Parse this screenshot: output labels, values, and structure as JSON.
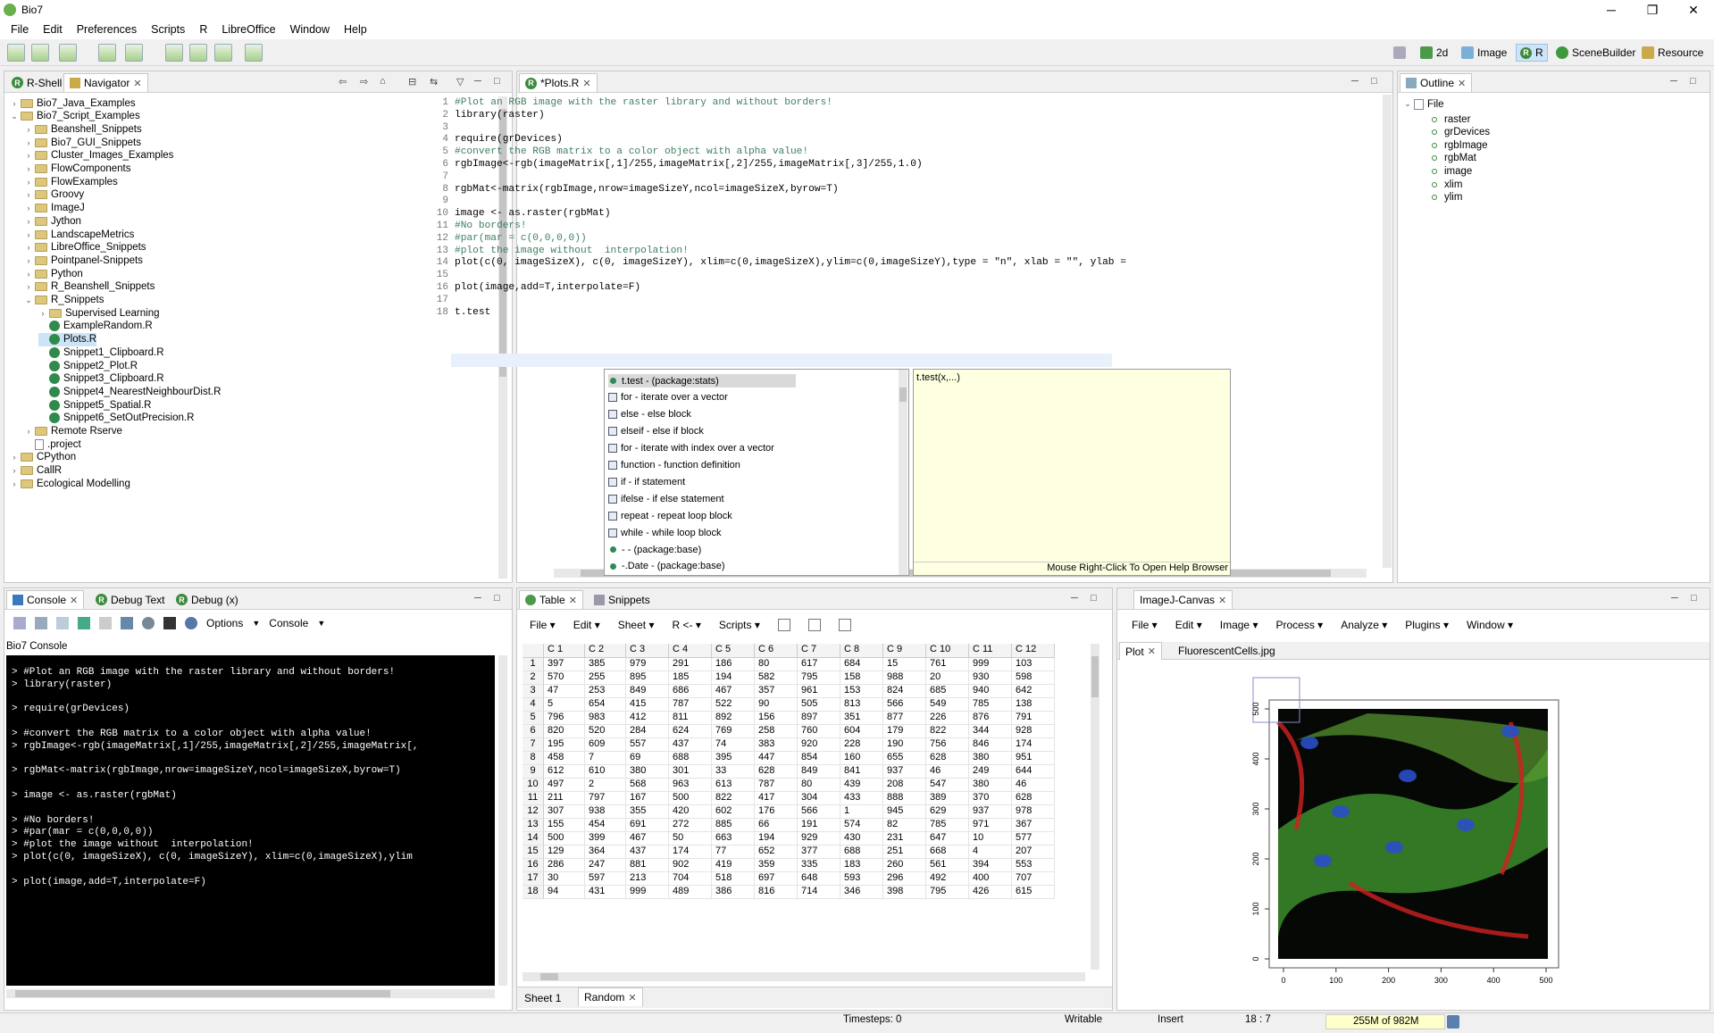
{
  "app": {
    "title": "Bio7"
  },
  "menu": [
    "File",
    "Edit",
    "Preferences",
    "Scripts",
    "R",
    "LibreOffice",
    "Window",
    "Help"
  ],
  "perspectives": [
    "2d",
    "Image",
    "R",
    "SceneBuilder",
    "Resource"
  ],
  "left_panel": {
    "tabs": [
      "R-Shell",
      "Navigator"
    ],
    "tree": [
      {
        "label": "Bio7_Java_Examples",
        "level": 0,
        "type": "folder",
        "arrow": "›"
      },
      {
        "label": "Bio7_Script_Examples",
        "level": 0,
        "type": "folder",
        "arrow": "⌄"
      },
      {
        "label": "Beanshell_Snippets",
        "level": 1,
        "type": "folder",
        "arrow": "›"
      },
      {
        "label": "Bio7_GUI_Snippets",
        "level": 1,
        "type": "folder",
        "arrow": "›"
      },
      {
        "label": "Cluster_Images_Examples",
        "level": 1,
        "type": "folder",
        "arrow": "›"
      },
      {
        "label": "FlowComponents",
        "level": 1,
        "type": "folder",
        "arrow": "›"
      },
      {
        "label": "FlowExamples",
        "level": 1,
        "type": "folder",
        "arrow": "›"
      },
      {
        "label": "Groovy",
        "level": 1,
        "type": "folder",
        "arrow": "›"
      },
      {
        "label": "ImageJ",
        "level": 1,
        "type": "folder",
        "arrow": "›"
      },
      {
        "label": "Jython",
        "level": 1,
        "type": "folder",
        "arrow": "›"
      },
      {
        "label": "LandscapeMetrics",
        "level": 1,
        "type": "folder",
        "arrow": "›"
      },
      {
        "label": "LibreOffice_Snippets",
        "level": 1,
        "type": "folder",
        "arrow": "›"
      },
      {
        "label": "Pointpanel-Snippets",
        "level": 1,
        "type": "folder",
        "arrow": "›"
      },
      {
        "label": "Python",
        "level": 1,
        "type": "folder",
        "arrow": "›"
      },
      {
        "label": "R_Beanshell_Snippets",
        "level": 1,
        "type": "folder",
        "arrow": "›"
      },
      {
        "label": "R_Snippets",
        "level": 1,
        "type": "folder",
        "arrow": "⌄"
      },
      {
        "label": "Supervised Learning",
        "level": 2,
        "type": "folder",
        "arrow": "›"
      },
      {
        "label": "ExampleRandom.R",
        "level": 2,
        "type": "file",
        "arrow": ""
      },
      {
        "label": "Plots.R",
        "level": 2,
        "type": "file",
        "arrow": "",
        "selected": true
      },
      {
        "label": "Snippet1_Clipboard.R",
        "level": 2,
        "type": "file",
        "arrow": ""
      },
      {
        "label": "Snippet2_Plot.R",
        "level": 2,
        "type": "file",
        "arrow": ""
      },
      {
        "label": "Snippet3_Clipboard.R",
        "level": 2,
        "type": "file",
        "arrow": ""
      },
      {
        "label": "Snippet4_NearestNeighbourDist.R",
        "level": 2,
        "type": "file",
        "arrow": ""
      },
      {
        "label": "Snippet5_Spatial.R",
        "level": 2,
        "type": "file",
        "arrow": ""
      },
      {
        "label": "Snippet6_SetOutPrecision.R",
        "level": 2,
        "type": "file",
        "arrow": ""
      },
      {
        "label": "Remote Rserve",
        "level": 1,
        "type": "folder",
        "arrow": "›"
      },
      {
        "label": ".project",
        "level": 1,
        "type": "doc",
        "arrow": ""
      },
      {
        "label": "CPython",
        "level": 0,
        "type": "folder",
        "arrow": "›"
      },
      {
        "label": "CallR",
        "level": 0,
        "type": "folder",
        "arrow": "›"
      },
      {
        "label": "Ecological Modelling",
        "level": 0,
        "type": "folder",
        "arrow": "›"
      }
    ]
  },
  "editor": {
    "tab": "*Plots.R",
    "lines": [
      {
        "n": "1",
        "text": "#Plot an RGB image with the raster library and without borders!",
        "comment": true
      },
      {
        "n": "2",
        "text": "library(raster)",
        "comment": false
      },
      {
        "n": "3",
        "text": "",
        "comment": false
      },
      {
        "n": "4",
        "text": "require(grDevices)",
        "comment": false
      },
      {
        "n": "5",
        "text": "#convert the RGB matrix to a color object with alpha value!",
        "comment": true
      },
      {
        "n": "6",
        "text": "rgbImage<-rgb(imageMatrix[,1]/255,imageMatrix[,2]/255,imageMatrix[,3]/255,1.0)",
        "comment": false
      },
      {
        "n": "7",
        "text": "",
        "comment": false
      },
      {
        "n": "8",
        "text": "rgbMat<-matrix(rgbImage,nrow=imageSizeY,ncol=imageSizeX,byrow=T)",
        "comment": false
      },
      {
        "n": "9",
        "text": "",
        "comment": false
      },
      {
        "n": "10",
        "text": "image <- as.raster(rgbMat)",
        "comment": false
      },
      {
        "n": "11",
        "text": "#No borders!",
        "comment": true
      },
      {
        "n": "12",
        "text": "#par(mar = c(0,0,0,0))",
        "comment": true
      },
      {
        "n": "13",
        "text": "#plot the image without  interpolation!",
        "comment": true
      },
      {
        "n": "14",
        "text": "plot(c(0, imageSizeX), c(0, imageSizeY), xlim=c(0,imageSizeX),ylim=c(0,imageSizeY),type = \"n\", xlab = \"\", ylab =",
        "comment": false
      },
      {
        "n": "15",
        "text": "",
        "comment": false
      },
      {
        "n": "16",
        "text": "plot(image,add=T,interpolate=F)",
        "comment": false
      },
      {
        "n": "17",
        "text": "",
        "comment": false
      },
      {
        "n": "18",
        "text": "t.test",
        "comment": false
      }
    ],
    "autocomplete": {
      "items": [
        {
          "label": "t.test - (package:stats)",
          "kind": "dot"
        },
        {
          "label": "for - iterate over a vector",
          "kind": "tpl"
        },
        {
          "label": "else - else block",
          "kind": "tpl"
        },
        {
          "label": "elseif - else if block",
          "kind": "tpl"
        },
        {
          "label": "for - iterate with index over a vector",
          "kind": "tpl"
        },
        {
          "label": "function - function definition",
          "kind": "tpl"
        },
        {
          "label": "if - if statement",
          "kind": "tpl"
        },
        {
          "label": "ifelse - if else statement",
          "kind": "tpl"
        },
        {
          "label": "repeat - repeat loop block",
          "kind": "tpl"
        },
        {
          "label": "while - while loop block",
          "kind": "tpl"
        },
        {
          "label": "- - (package:base)",
          "kind": "dot"
        },
        {
          "label": "-.Date - (package:base)",
          "kind": "dot"
        }
      ],
      "help_signature": "t.test(x,...)",
      "help_footer": "Mouse Right-Click To Open Help Browser"
    }
  },
  "outline": {
    "tab": "Outline",
    "root": "File",
    "items": [
      "raster",
      "grDevices",
      "rgbImage",
      "rgbMat",
      "image",
      "xlim",
      "ylim"
    ]
  },
  "console": {
    "tabs": [
      "Console",
      "Debug Text",
      "Debug (x)"
    ],
    "toolbar": {
      "options": "Options",
      "console": "Console"
    },
    "title": "Bio7 Console",
    "lines": [
      "> #Plot an RGB image with the raster library and without borders!",
      "> library(raster)",
      "",
      "> require(grDevices)",
      "",
      "> #convert the RGB matrix to a color object with alpha value!",
      "> rgbImage<-rgb(imageMatrix[,1]/255,imageMatrix[,2]/255,imageMatrix[,",
      "",
      "> rgbMat<-matrix(rgbImage,nrow=imageSizeY,ncol=imageSizeX,byrow=T)",
      "",
      "> image <- as.raster(rgbMat)",
      "",
      "> #No borders!",
      "> #par(mar = c(0,0,0,0))",
      "> #plot the image without  interpolation!",
      "> plot(c(0, imageSizeX), c(0, imageSizeY), xlim=c(0,imageSizeX),ylim",
      "",
      "> plot(image,add=T,interpolate=F)"
    ]
  },
  "table": {
    "tabs": [
      "Table",
      "Snippets"
    ],
    "menu": [
      "File",
      "Edit",
      "Sheet",
      "R <-",
      "Scripts"
    ],
    "columns": [
      "C 1",
      "C 2",
      "C 3",
      "C 4",
      "C 5",
      "C 6",
      "C 7",
      "C 8",
      "C 9",
      "C 10",
      "C 11",
      "C 12"
    ],
    "rows": [
      [
        "397",
        "385",
        "979",
        "291",
        "186",
        "80",
        "617",
        "684",
        "15",
        "761",
        "999",
        "103"
      ],
      [
        "570",
        "255",
        "895",
        "185",
        "194",
        "582",
        "795",
        "158",
        "988",
        "20",
        "930",
        "598"
      ],
      [
        "47",
        "253",
        "849",
        "686",
        "467",
        "357",
        "961",
        "153",
        "824",
        "685",
        "940",
        "642"
      ],
      [
        "5",
        "654",
        "415",
        "787",
        "522",
        "90",
        "505",
        "813",
        "566",
        "549",
        "785",
        "138"
      ],
      [
        "796",
        "983",
        "412",
        "811",
        "892",
        "156",
        "897",
        "351",
        "877",
        "226",
        "876",
        "791"
      ],
      [
        "820",
        "520",
        "284",
        "624",
        "769",
        "258",
        "760",
        "604",
        "179",
        "822",
        "344",
        "928"
      ],
      [
        "195",
        "609",
        "557",
        "437",
        "74",
        "383",
        "920",
        "228",
        "190",
        "756",
        "846",
        "174"
      ],
      [
        "458",
        "7",
        "69",
        "688",
        "395",
        "447",
        "854",
        "160",
        "655",
        "628",
        "380",
        "951"
      ],
      [
        "612",
        "610",
        "380",
        "301",
        "33",
        "628",
        "849",
        "841",
        "937",
        "46",
        "249",
        "644"
      ],
      [
        "497",
        "2",
        "568",
        "963",
        "613",
        "787",
        "80",
        "439",
        "208",
        "547",
        "380",
        "46"
      ],
      [
        "211",
        "797",
        "167",
        "500",
        "822",
        "417",
        "304",
        "433",
        "888",
        "389",
        "370",
        "628"
      ],
      [
        "307",
        "938",
        "355",
        "420",
        "602",
        "176",
        "566",
        "1",
        "945",
        "629",
        "937",
        "978"
      ],
      [
        "155",
        "454",
        "691",
        "272",
        "885",
        "66",
        "191",
        "574",
        "82",
        "785",
        "971",
        "367"
      ],
      [
        "500",
        "399",
        "467",
        "50",
        "663",
        "194",
        "929",
        "430",
        "231",
        "647",
        "10",
        "577"
      ],
      [
        "129",
        "364",
        "437",
        "174",
        "77",
        "652",
        "377",
        "688",
        "251",
        "668",
        "4",
        "207"
      ],
      [
        "286",
        "247",
        "881",
        "902",
        "419",
        "359",
        "335",
        "183",
        "260",
        "561",
        "394",
        "553"
      ],
      [
        "30",
        "597",
        "213",
        "704",
        "518",
        "697",
        "648",
        "593",
        "296",
        "492",
        "400",
        "707"
      ],
      [
        "94",
        "431",
        "999",
        "489",
        "386",
        "816",
        "714",
        "346",
        "398",
        "795",
        "426",
        "615"
      ]
    ],
    "sheets": [
      "Sheet 1",
      "Random"
    ]
  },
  "imagej": {
    "tab": "ImageJ-Canvas",
    "menu": [
      "File",
      "Edit",
      "Image",
      "Process",
      "Analyze",
      "Plugins",
      "Window"
    ],
    "subtabs": [
      "Plot",
      "FluorescentCells.jpg"
    ],
    "x_ticks": [
      "0",
      "100",
      "200",
      "300",
      "400",
      "500"
    ],
    "y_ticks": [
      "0",
      "100",
      "200",
      "300",
      "400",
      "500"
    ]
  },
  "status": {
    "timesteps": "Timesteps: 0",
    "writable": "Writable",
    "insert": "Insert",
    "position": "18 : 7",
    "memory": "255M of 982M"
  }
}
